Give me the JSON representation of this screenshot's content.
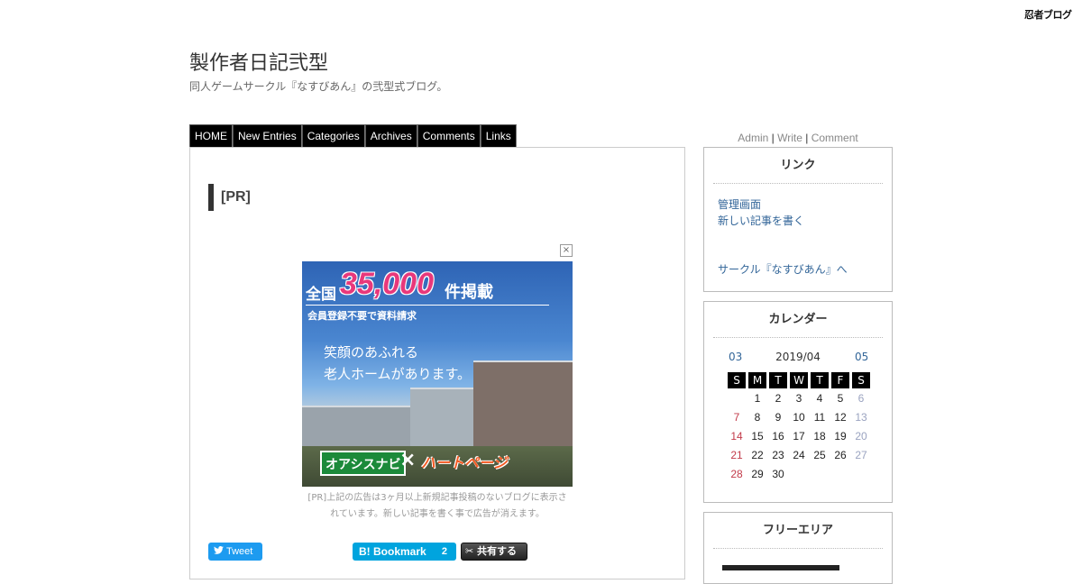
{
  "logo": "忍者ブログ",
  "site": {
    "title": "製作者日記弐型",
    "description": "同人ゲームサークル『なすびあん』の弐型式ブログ。"
  },
  "nav": [
    "HOME",
    "New Entries",
    "Categories",
    "Archives",
    "Comments",
    "Links"
  ],
  "entry": {
    "title": "[PR]",
    "ad": {
      "close": "×",
      "zenkoku": "全国",
      "number": "35,000",
      "kenkeisai": "件掲載",
      "sub": "会員登録不要で資料請求",
      "copy1": "笑顔のあふれる",
      "copy2": "老人ホームがあります。",
      "brand1": "オアシスナビ",
      "x": "×",
      "brand2": "ハートページ"
    },
    "ad_notice_1": "[PR]上記の広告は3ヶ月以上新規記事投稿のないブログに表示さ",
    "ad_notice_2": "れています。新しい記事を書く事で広告が消えます。",
    "tweet": "Tweet",
    "hatena": "B! Bookmark",
    "hatena_count": "2",
    "share": "共有する"
  },
  "admin": {
    "admin": "Admin",
    "sep1": "|",
    "write": "Write",
    "sep2": "|",
    "comment": "Comment"
  },
  "sidebar": {
    "links": {
      "title": "リンク",
      "items": [
        "管理画面",
        "新しい記事を書く",
        "サークル『なすびあん』へ"
      ]
    },
    "calendar": {
      "title": "カレンダー",
      "prev": "03",
      "month": "2019/04",
      "next": "05",
      "weekdays": [
        "S",
        "M",
        "T",
        "W",
        "T",
        "F",
        "S"
      ],
      "weeks": [
        [
          "",
          "1",
          "2",
          "3",
          "4",
          "5",
          "6"
        ],
        [
          "7",
          "8",
          "9",
          "10",
          "11",
          "12",
          "13"
        ],
        [
          "14",
          "15",
          "16",
          "17",
          "18",
          "19",
          "20"
        ],
        [
          "21",
          "22",
          "23",
          "24",
          "25",
          "26",
          "27"
        ],
        [
          "28",
          "29",
          "30",
          "",
          "",
          "",
          ""
        ]
      ]
    },
    "free": {
      "title": "フリーエリア"
    }
  }
}
